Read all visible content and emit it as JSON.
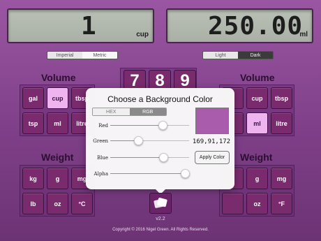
{
  "display": {
    "left": {
      "value": "1",
      "unit": "cup"
    },
    "right": {
      "value": "250.00",
      "unit": "ml"
    }
  },
  "system_toggle": {
    "options": [
      "Imperial",
      "Metric"
    ],
    "selected": "Metric"
  },
  "theme_toggle": {
    "options": [
      "Light",
      "Dark"
    ],
    "selected": "Dark"
  },
  "left_panel": {
    "volume_title": "Volume",
    "volume_units": [
      "gal",
      "cup",
      "tbsp",
      "tsp",
      "ml",
      "litre"
    ],
    "volume_selected": "cup",
    "weight_title": "Weight",
    "weight_units": [
      "kg",
      "g",
      "mg",
      "lb",
      "oz",
      "°C"
    ]
  },
  "right_panel": {
    "volume_title": "Volume",
    "volume_units": [
      "",
      "cup",
      "tbsp",
      "",
      "ml",
      "litre"
    ],
    "volume_selected": "ml",
    "weight_title": "Weight",
    "weight_units": [
      "",
      "g",
      "mg",
      "",
      "oz",
      "°F"
    ]
  },
  "keypad": {
    "visible_keys": [
      "7",
      "8",
      "9"
    ]
  },
  "color_picker": {
    "title": "Choose a Background Color",
    "modes": [
      "HEX",
      "RGB"
    ],
    "selected_mode": "RGB",
    "sliders": [
      {
        "label": "Red",
        "value": 169
      },
      {
        "label": "Green",
        "value": 91
      },
      {
        "label": "Blue",
        "value": 172
      },
      {
        "label": "Alpha",
        "value": 255
      }
    ],
    "rgb_text": "169,91,172",
    "apply_label": "Apply Color",
    "swatch_color": "#a95bac"
  },
  "share_icon": "share-icon",
  "version": "v2.2",
  "copyright": "Copyright © 2016 Nigel Green. All Rights Reserved.",
  "colors": {
    "accent": "#7a2b6e",
    "selected_key": "#efb4ef",
    "lcd": "#b3bab0"
  }
}
